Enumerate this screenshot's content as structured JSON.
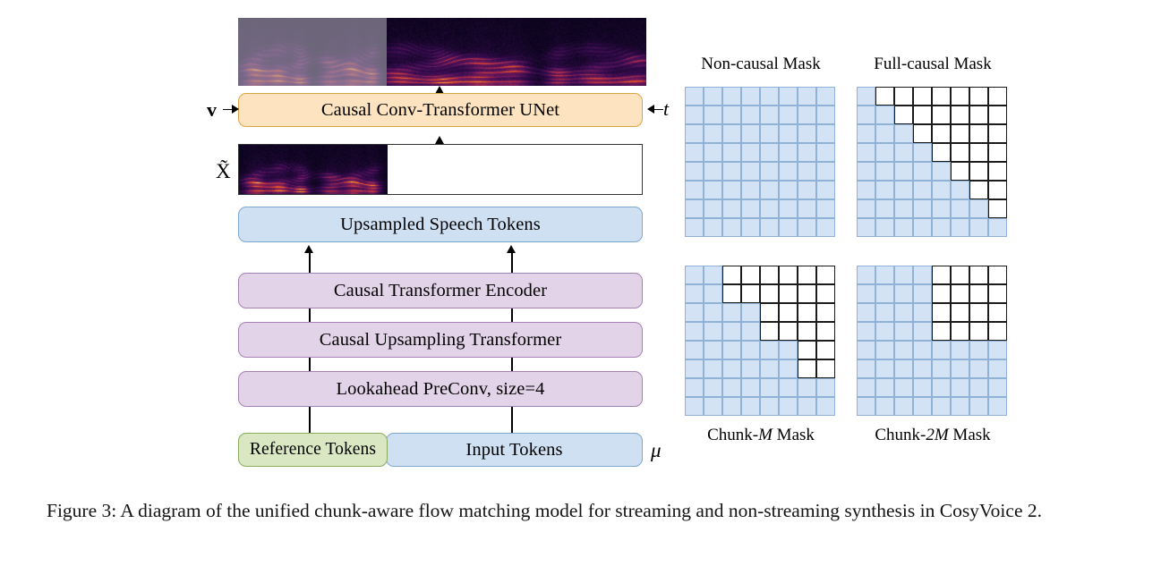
{
  "figure": {
    "caption": "Figure 3: A diagram of the unified chunk-aware flow matching model for streaming and non-streaming synthesis in CosyVoice 2."
  },
  "pipeline": {
    "unet_box": "Causal Conv-Transformer UNet",
    "upsampled_tokens_box": "Upsampled Speech Tokens",
    "encoder_box": "Causal Transformer Encoder",
    "upsampling_box": "Causal Upsampling Transformer",
    "preconv_box": "Lookahead PreConv, size=4",
    "reference_tokens_box": "Reference Tokens",
    "input_tokens_box": "Input Tokens",
    "labels": {
      "velocity": "v",
      "timestep": "t",
      "noisy_mel": "X̃",
      "mu": "μ"
    }
  },
  "masks": [
    {
      "id": "non-causal",
      "label": "Non-causal Mask",
      "label_plain": "Non-causal Mask",
      "label_position": "top",
      "size": 8,
      "visible_per_row": [
        8,
        8,
        8,
        8,
        8,
        8,
        8,
        8
      ]
    },
    {
      "id": "full-causal",
      "label": "Full-causal Mask",
      "label_plain": "Full-causal Mask",
      "label_position": "top",
      "size": 8,
      "visible_per_row": [
        1,
        2,
        3,
        4,
        5,
        6,
        7,
        8
      ]
    },
    {
      "id": "chunk-m",
      "label_html": "Chunk-<i>M</i> Mask",
      "label_plain": "Chunk-M Mask",
      "label_position": "bottom",
      "size": 8,
      "chunk": 2,
      "visible_per_row": [
        2,
        2,
        4,
        4,
        6,
        6,
        8,
        8
      ]
    },
    {
      "id": "chunk-2m",
      "label_html": "Chunk-<i>2M</i> Mask",
      "label_plain": "Chunk-2M Mask",
      "label_position": "bottom",
      "size": 8,
      "chunk": 4,
      "visible_per_row": [
        4,
        4,
        4,
        4,
        8,
        8,
        8,
        8
      ]
    }
  ],
  "colors": {
    "mask_on": "#d3e3f5",
    "mask_on_border": "#8fb2d6",
    "mask_off": "#ffffff",
    "mask_off_border": "#1b1b1b",
    "orange_box": "#fde3bf",
    "orange_border": "#d9a441",
    "blue_box": "#cfe0f3",
    "blue_border": "#7fa6cf",
    "purple_box": "#e3d3e8",
    "purple_border": "#a781b5",
    "green_box": "#d9e7c2",
    "green_border": "#8aab5e"
  }
}
